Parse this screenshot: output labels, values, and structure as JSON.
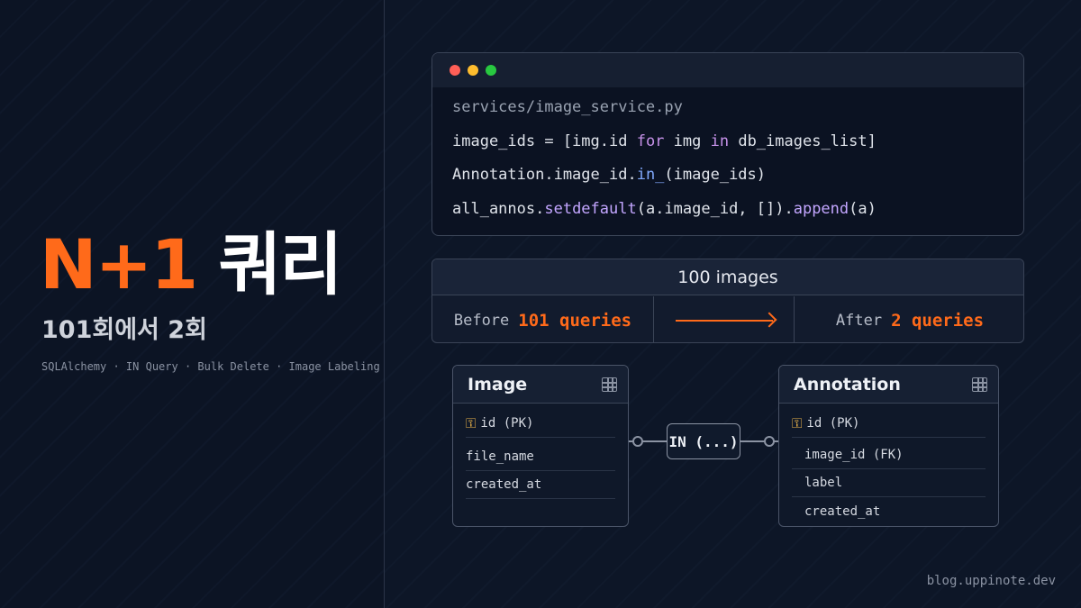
{
  "hero": {
    "title_accent": "N+1",
    "title_main": "쿼리",
    "subtitle": "101회에서 2회",
    "tags": "SQLAlchemy · IN Query · Bulk Delete · Image Labeling"
  },
  "code": {
    "filename": "services/image_service.py",
    "line1": {
      "a": "image_ids = [img.id ",
      "kw1": "for",
      "b": " img ",
      "kw2": "in",
      "c": " db_images_list]"
    },
    "line2": {
      "a": "Annotation.image_id.",
      "fn": "in_",
      "b": "(image_ids)"
    },
    "line3": {
      "a": "all_annos.",
      "fn1": "setdefault",
      "b": "(a.image_id, []).",
      "fn2": "append",
      "c": "(a)"
    }
  },
  "comparison": {
    "header": "100 images",
    "before_label": "Before",
    "before_value": "101 queries",
    "after_label": "After",
    "after_value": "2 queries"
  },
  "er": {
    "image_table": {
      "title": "Image",
      "rows": [
        "id (PK)",
        "file_name",
        "created_at"
      ]
    },
    "annotation_table": {
      "title": "Annotation",
      "rows": [
        "id (PK)",
        "image_id (FK)",
        "label",
        "created_at"
      ]
    },
    "join_label": "IN (...)"
  },
  "footer": "blog.uppinote.dev",
  "colors": {
    "accent": "#ff6a1a",
    "background": "#0d1526",
    "keyword": "#c792ea",
    "function": "#82aaff"
  },
  "icons": [
    "key-icon",
    "table-icon"
  ]
}
